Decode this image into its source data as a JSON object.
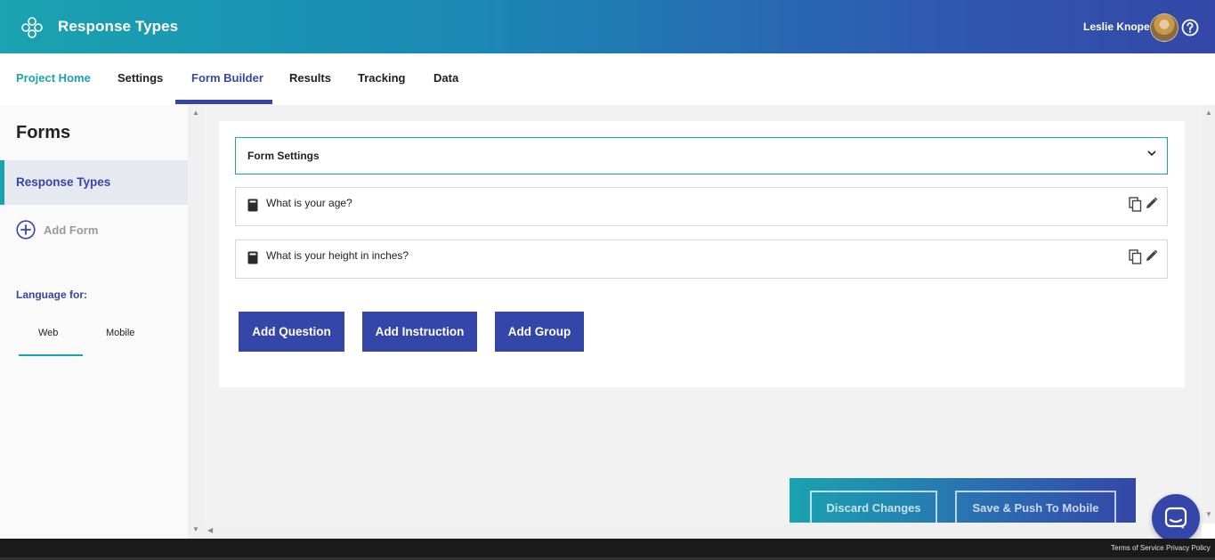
{
  "header": {
    "app_title": "Response Types",
    "user_name": "Leslie Knope",
    "logo_icon": "flower-logo-icon",
    "help_icon": "help-circle-icon"
  },
  "nav": {
    "items": [
      {
        "label": "Project Home"
      },
      {
        "label": "Settings"
      },
      {
        "label": "Form Builder"
      },
      {
        "label": "Results"
      },
      {
        "label": "Tracking"
      },
      {
        "label": "Data"
      }
    ],
    "active": "Form Builder"
  },
  "sidebar": {
    "title": "Forms",
    "forms": [
      {
        "label": "Response Types"
      }
    ],
    "add_form_label": "Add Form",
    "language_label": "Language for:",
    "language_tabs": [
      {
        "label": "Web"
      },
      {
        "label": "Mobile"
      }
    ],
    "active_language": "Web"
  },
  "main": {
    "form_settings_label": "Form Settings",
    "questions": [
      {
        "text": "What is your age?",
        "icon": "number-field-icon"
      },
      {
        "text": "What is your height in inches?",
        "icon": "number-field-icon"
      }
    ],
    "buttons": {
      "add_question": "Add Question",
      "add_instruction": "Add Instruction",
      "add_group": "Add Group"
    }
  },
  "action_bar": {
    "discard": "Discard Changes",
    "save_push": "Save & Push To Mobile"
  },
  "footer": {
    "terms": "Terms of Service",
    "privacy": "Privacy Policy"
  },
  "colors": {
    "accent_teal": "#1aa3b0",
    "accent_indigo": "#3447a8"
  }
}
